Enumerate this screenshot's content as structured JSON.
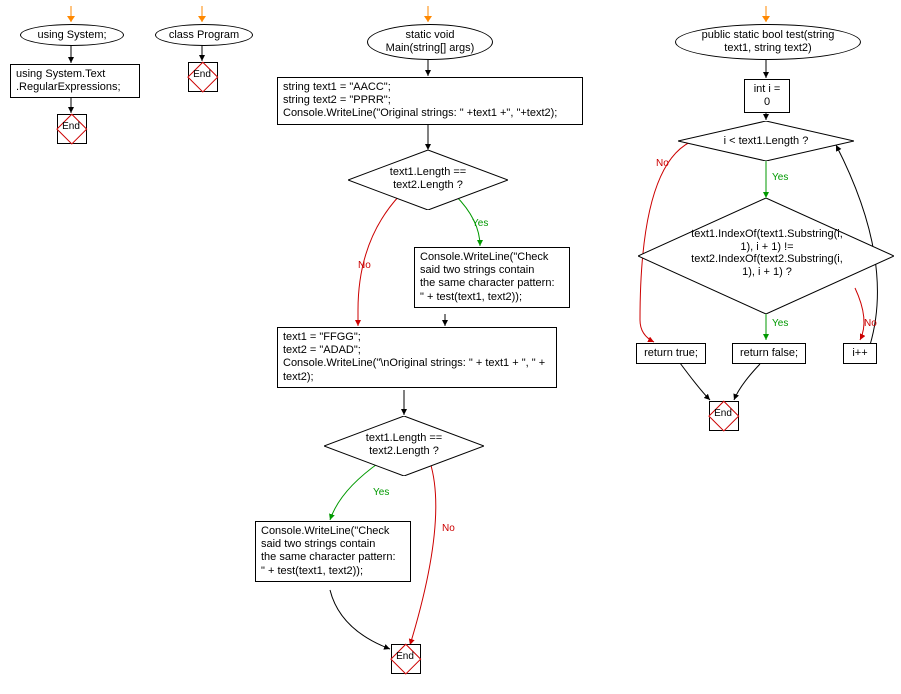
{
  "chart_data": {
    "type": "flowchart",
    "title": "",
    "swimlanes": [
      {
        "name": "using-system",
        "entry": "using System;",
        "steps": [
          {
            "id": "stmt-regex",
            "kind": "process",
            "text": "using System.Text\n.RegularExpressions;"
          },
          {
            "id": "end1",
            "kind": "terminator",
            "text": "End"
          }
        ]
      },
      {
        "name": "class-program",
        "entry": "class Program",
        "steps": [
          {
            "id": "end2",
            "kind": "terminator",
            "text": "End"
          }
        ]
      },
      {
        "name": "main",
        "entry": "static void\nMain(string[] args)",
        "steps": [
          {
            "id": "init1",
            "kind": "process",
            "text": "string text1 = \"AACC\";\nstring text2 = \"PPRR\";\nConsole.WriteLine(\"Original strings: \" +text1 +\", \"+text2);"
          },
          {
            "id": "dec1",
            "kind": "decision",
            "text": "text1.Length ==\ntext2.Length ?",
            "yes": "print1",
            "no": "init2"
          },
          {
            "id": "print1",
            "kind": "process",
            "text": "Console.WriteLine(\"Check\nsaid two strings contain\nthe same character pattern:\n\" + test(text1, text2));"
          },
          {
            "id": "init2",
            "kind": "process",
            "text": "text1 = \"FFGG\";\ntext2 = \"ADAD\";\nConsole.WriteLine(\"\\nOriginal strings: \" + text1 + \", \" +\ntext2);"
          },
          {
            "id": "dec2",
            "kind": "decision",
            "text": "text1.Length ==\ntext2.Length ?",
            "yes": "print2",
            "no": "end3"
          },
          {
            "id": "print2",
            "kind": "process",
            "text": "Console.WriteLine(\"Check\nsaid two strings contain\nthe same character pattern:\n\" + test(text1, text2));"
          },
          {
            "id": "end3",
            "kind": "terminator",
            "text": "End"
          }
        ]
      },
      {
        "name": "test-func",
        "entry": "public static bool test(string\ntext1, string text2)",
        "steps": [
          {
            "id": "initI",
            "kind": "process",
            "text": "int i = 0"
          },
          {
            "id": "loopCond",
            "kind": "decision",
            "text": "i < text1.Length ?",
            "yes": "idxCond",
            "no": "retTrue"
          },
          {
            "id": "idxCond",
            "kind": "decision",
            "text": "text1.IndexOf(text1.Substring(i,\n1), i + 1) !=\ntext2.IndexOf(text2.Substring(i,\n1), i + 1) ?",
            "yes": "retFalse",
            "no": "incr"
          },
          {
            "id": "retTrue",
            "kind": "process",
            "text": "return true;"
          },
          {
            "id": "retFalse",
            "kind": "process",
            "text": "return false;"
          },
          {
            "id": "incr",
            "kind": "process",
            "text": "i++"
          },
          {
            "id": "end4",
            "kind": "terminator",
            "text": "End"
          }
        ]
      }
    ]
  },
  "labels": {
    "yes": "Yes",
    "no": "No",
    "end": "End"
  }
}
